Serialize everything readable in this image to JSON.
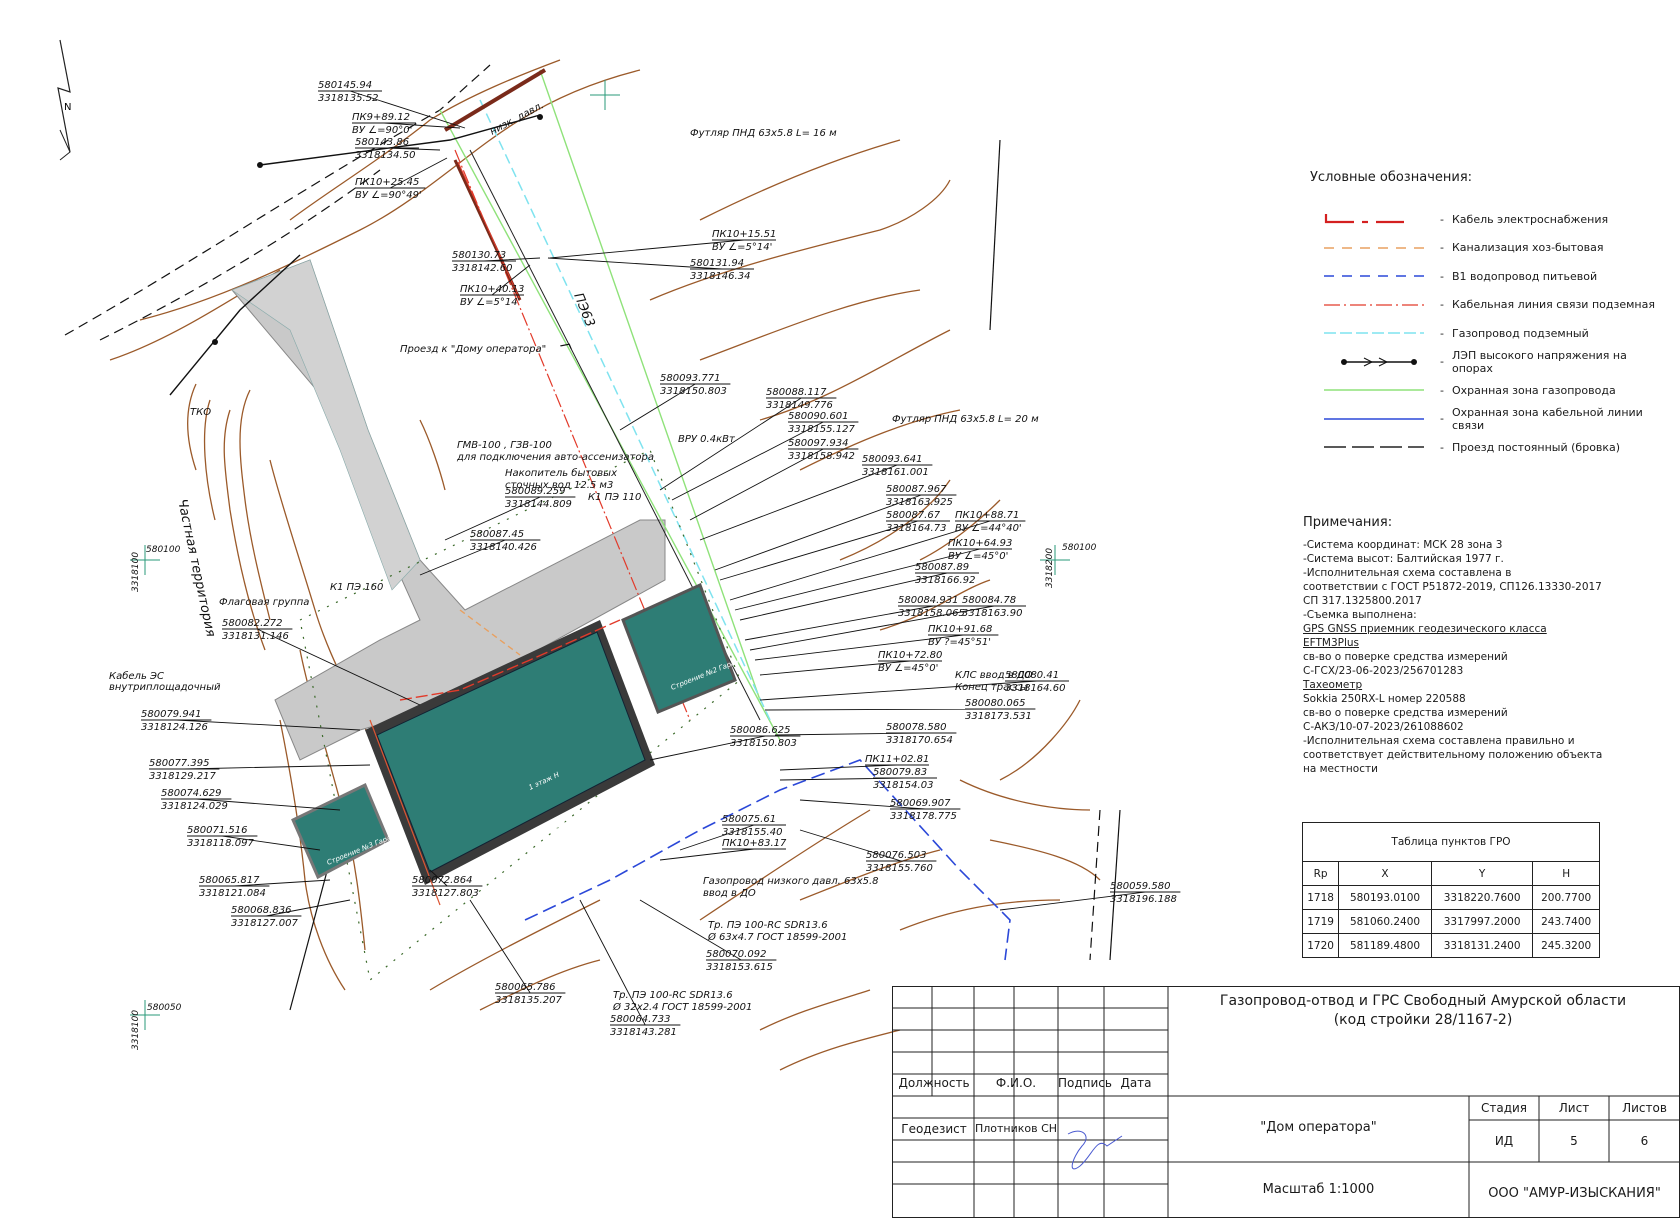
{
  "north": {
    "label": "N"
  },
  "legend": {
    "title": "Условные обозначения:",
    "dash": "-",
    "items": [
      {
        "text": "Кабель электроснабжения",
        "icon": "red-cable-line"
      },
      {
        "text": "Канализация хоз-бытовая",
        "icon": "orange-dashed-line"
      },
      {
        "text": "В1 водопровод питьевой",
        "icon": "blue-dashed-line"
      },
      {
        "text": "Кабельная линия связи подземная",
        "icon": "red-dashdot-line"
      },
      {
        "text": "Газопровод подземный",
        "icon": "cyan-dashed-line"
      },
      {
        "text": "ЛЭП высокого напряжения на опорах",
        "icon": "black-arrows-line"
      },
      {
        "text": "Охранная зона газопровода",
        "icon": "green-line"
      },
      {
        "text": "Охранная зона кабельной линии связи",
        "icon": "blue-line"
      },
      {
        "text": "Проезд постоянный (бровка)",
        "icon": "black-dashed-line"
      }
    ]
  },
  "notes": {
    "title": "Примечания:",
    "lines": [
      "-Система координат: МСК 28 зона 3",
      "-Система высот: Балтийская 1977 г.",
      "-Исполнительная схема составлена в",
      "соответствии с ГОСТ Р51872-2019, СП126.13330-2017",
      "СП 317.1325800.2017",
      "-Съемка выполнена:",
      "GPS GNSS приемник геодезического класса",
      "EFTM3Plus",
      "св-во о поверке средства измерений",
      "С-ГСХ/23-06-2023/256701283",
      "Тахеометр",
      "Sokkia 250RX-L номер 220588",
      "св-во о поверке средства измерений",
      "С-АКЗ/10-07-2023/261088602",
      "-Исполнительная схема составлена правильно и",
      "соответствует действительному положению объекта",
      "на местности"
    ]
  },
  "gro_table": {
    "caption": "Таблица пунктов ГРО",
    "headers": [
      "Rp",
      "X",
      "Y",
      "H"
    ],
    "rows": [
      [
        "1718",
        "580193.0100",
        "3318220.7600",
        "200.7700"
      ],
      [
        "1719",
        "581060.2400",
        "3317997.2000",
        "243.7400"
      ],
      [
        "1720",
        "581189.4800",
        "3318131.2400",
        "245.3200"
      ]
    ]
  },
  "title_block": {
    "project_line1": "Газопровод-отвод и ГРС Свободный Амурской области",
    "project_line2": "(код стройки 28/1167-2)",
    "col_position": "Должность",
    "col_name": "Ф.И.О.",
    "col_signature": "Подпись",
    "col_date": "Дата",
    "role": "Геодезист",
    "person": "Плотников СН",
    "sheet_title": "\"Дом оператора\"",
    "stage_label": "Стадия",
    "sheet_label": "Лист",
    "sheets_label": "Листов",
    "stage": "ИД",
    "sheet": "5",
    "sheets": "6",
    "scale": "Масштаб 1:1000",
    "company": "ООО \"АМУР-ИЗЫСКАНИЯ\""
  },
  "map_labels": {
    "grid_580100_left": "580100",
    "grid_3318100_left": "3318100",
    "grid_580100_right": "580100",
    "grid_3318200_right": "3318200",
    "grid_580050": "580050",
    "grid_3318100_bottom": "3318100",
    "private_territory": "Частная территория",
    "pipe_low_pressure": "низк. давл.",
    "pipe_code": "ПЭ63",
    "pipe_letter": "Г",
    "driveway": "Проезд к \"Дому оператора\"",
    "tko": "ТКО",
    "flag_group": "Флаговая группа",
    "cable_es_1": "Кабель ЭС",
    "cable_es_2": "внутриплощадочный",
    "gmv_1": "ГМВ-100 , ГЗВ-100",
    "gmv_2": "для подключения авто-ассенизатора",
    "storage_1": "Накопитель бытовых",
    "storage_2": "сточных вод 12.5 м3",
    "k1pe110": "К1 ПЭ 110",
    "k1pe160": "К1 ПЭ 160",
    "vru": "ВРУ 0.4кВт",
    "sleeve1": "Футляр ПНД 63х5.8 L= 16 м",
    "sleeve2": "Футляр ПНД 63х5.8 L= 20 м",
    "kls1": "КЛС ввод в ДО",
    "kls2": "Конец трассы",
    "gas_low_1": "Газопровод низкого давл. 63х5.8",
    "gas_low_2": "ввод в ДО",
    "tr1_1": "Тр. ПЭ 100-RC SDR13.6",
    "tr1_2": "Ø 63х4.7 ГОСТ 18599-2001",
    "tr2_1": "Тр. ПЭ 100-RC SDR13.6",
    "tr2_2": "Ø 32х2.4 ГОСТ 18599-2001",
    "bld_main": "Строение №1 \"Дом оператора\"",
    "bld_2": "Строение №2 Гараж",
    "bld_3": "Строение №3 Гараж",
    "bld_temp": "1 этаж Н"
  },
  "callouts": [
    {
      "a": "580145.94",
      "b": "3318135.52"
    },
    {
      "a": "ПК9+89.12",
      "b": "ВУ ∠=90°0'"
    },
    {
      "a": "580143.86",
      "b": "3318134.50"
    },
    {
      "a": "ПК10+25.45",
      "b": "ВУ ∠=90°49'"
    },
    {
      "a": "580130.73",
      "b": "3318142.60"
    },
    {
      "a": "ПК10+40.13",
      "b": "ВУ ∠=5°14'"
    },
    {
      "a": "ПК10+15.51",
      "b": "ВУ ∠=5°14'"
    },
    {
      "a": "580131.94",
      "b": "3318146.34"
    },
    {
      "a": "580093.771",
      "b": "3318150.803"
    },
    {
      "a": "580088.117",
      "b": "3318149.776"
    },
    {
      "a": "580090.601",
      "b": "3318155.127"
    },
    {
      "a": "580097.934",
      "b": "3318158.942"
    },
    {
      "a": "580093.641",
      "b": "3318161.001"
    },
    {
      "a": "580089.259",
      "b": "3318144.809"
    },
    {
      "a": "580087.967",
      "b": "3318163.925"
    },
    {
      "a": "580087.67",
      "b": "3318164.73"
    },
    {
      "a": "ПК10+88.71",
      "b": "ВУ ∠=44°40'"
    },
    {
      "a": "580087.45",
      "b": "3318140.426"
    },
    {
      "a": "ПК10+64.93",
      "b": "ВУ ∠=45°0'"
    },
    {
      "a": "580087.89",
      "b": "3318166.92"
    },
    {
      "a": "580084.931",
      "b": "3318158.065"
    },
    {
      "a": "580084.78",
      "b": "3318163.90"
    },
    {
      "a": "580082.272",
      "b": "3318131.146"
    },
    {
      "a": "ПК10+91.68",
      "b": "ВУ ?=45°51'"
    },
    {
      "a": "ПК10+72.80",
      "b": "ВУ ∠=45°0'"
    },
    {
      "a": "580080.41",
      "b": "3318164.60"
    },
    {
      "a": "580080.065",
      "b": "3318173.531"
    },
    {
      "a": "580079.941",
      "b": "3318124.126"
    },
    {
      "a": "580086.625",
      "b": "3318150.803"
    },
    {
      "a": "580078.580",
      "b": "3318170.654"
    },
    {
      "a": "580077.395",
      "b": "3318129.217"
    },
    {
      "a": "ПК11+02.81",
      "b": ""
    },
    {
      "a": "580079.83",
      "b": "3318154.03"
    },
    {
      "a": "580074.629",
      "b": "3318124.029"
    },
    {
      "a": "580069.907",
      "b": "3318178.775"
    },
    {
      "a": "580075.61",
      "b": "3318155.40"
    },
    {
      "a": "580071.516",
      "b": "3318118.097"
    },
    {
      "a": "ПК10+83.17",
      "b": ""
    },
    {
      "a": "580076.503",
      "b": "3318155.760"
    },
    {
      "a": "580065.817",
      "b": "3318121.084"
    },
    {
      "a": "580072.864",
      "b": "3318127.803"
    },
    {
      "a": "580059.580",
      "b": "3318196.188"
    },
    {
      "a": "580068.836",
      "b": "3318127.007"
    },
    {
      "a": "580070.092",
      "b": "3318153.615"
    },
    {
      "a": "580065.786",
      "b": "3318135.207"
    },
    {
      "a": "580064.733",
      "b": "3318143.281"
    }
  ]
}
